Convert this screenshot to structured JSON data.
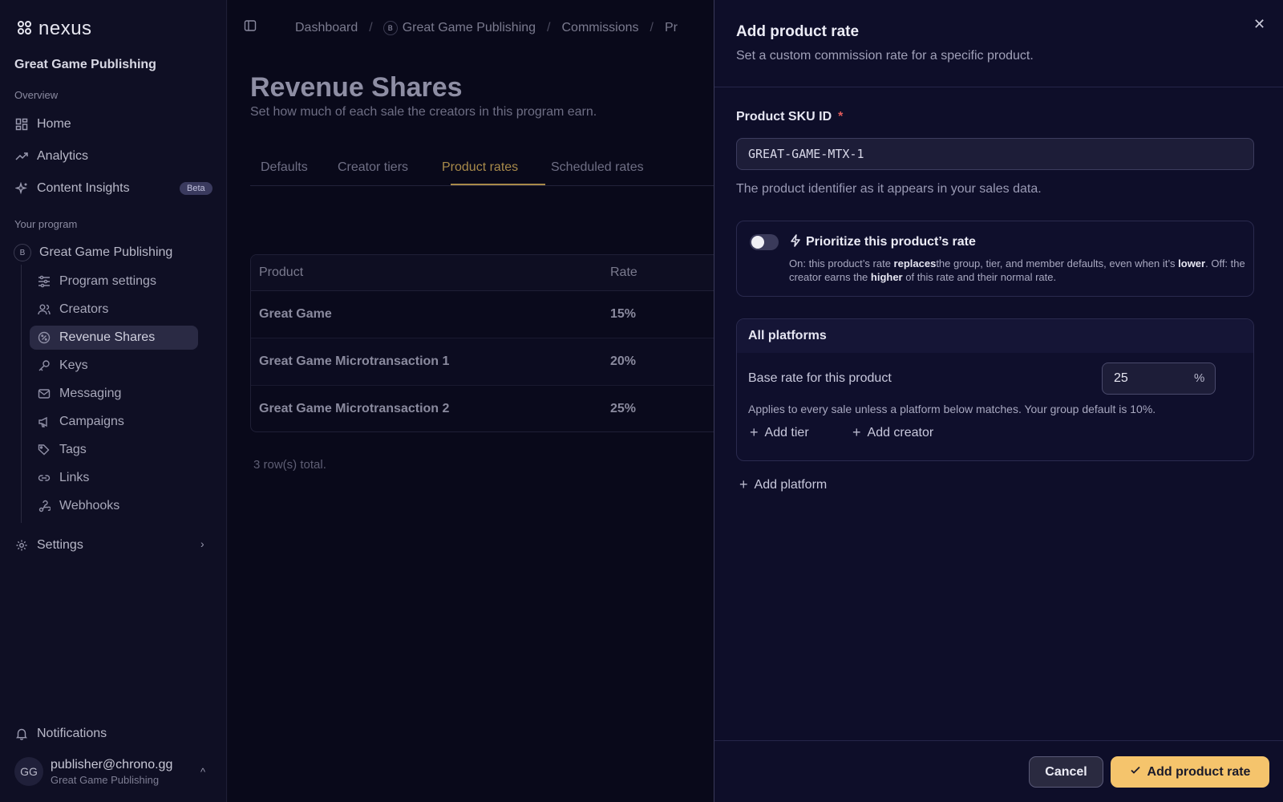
{
  "sidebar": {
    "logo_text": "nexus",
    "org_title": "Great Game Publishing",
    "overview_label": "Overview",
    "nav": [
      {
        "label": "Home"
      },
      {
        "label": "Analytics"
      },
      {
        "label": "Content Insights",
        "badge": "Beta"
      }
    ],
    "program_label": "Your program",
    "program_org": {
      "initial": "B",
      "label": "Great Game Publishing"
    },
    "program_items": [
      {
        "label": "Program settings"
      },
      {
        "label": "Creators"
      },
      {
        "label": "Revenue Shares",
        "active": true
      },
      {
        "label": "Keys"
      },
      {
        "label": "Messaging"
      },
      {
        "label": "Campaigns"
      },
      {
        "label": "Tags"
      },
      {
        "label": "Links"
      },
      {
        "label": "Webhooks"
      }
    ],
    "settings_label": "Settings",
    "notifications_label": "Notifications",
    "user": {
      "initials": "GG",
      "email": "publisher@chrono.gg",
      "org": "Great Game Publishing"
    }
  },
  "breadcrumb": {
    "items": [
      "Dashboard",
      "Great Game Publishing",
      "Commissions",
      "Pr"
    ],
    "org_initial": "B"
  },
  "main": {
    "title": "Revenue Shares",
    "subtitle": "Set how much of each sale the creators in this program earn.",
    "tabs": [
      "Defaults",
      "Creator tiers",
      "Product rates",
      "Scheduled rates"
    ],
    "active_tab": "Product rates",
    "table": {
      "headers": [
        "Product",
        "Rate"
      ],
      "rows": [
        {
          "product": "Great Game",
          "rate": "15%"
        },
        {
          "product": "Great Game Microtransaction 1",
          "rate": "20%"
        },
        {
          "product": "Great Game Microtransaction 2",
          "rate": "25%"
        }
      ]
    },
    "rows_total": "3 row(s) total."
  },
  "drawer": {
    "title": "Add product rate",
    "subtitle": "Set a custom commission rate for a specific product.",
    "sku_label": "Product SKU ID",
    "required_mark": "*",
    "sku_value": "GREAT-GAME-MTX-1",
    "sku_help": "The product identifier as it appears in your sales data.",
    "priority": {
      "title": "Prioritize this product’s rate",
      "enabled": false,
      "desc_1": "On: this product’s rate ",
      "desc_b1": "replaces",
      "desc_2": "the group, tier, and member defaults, even when it’s ",
      "desc_b2": "lower",
      "desc_3": ". Off: the creator earns the ",
      "desc_b3": "higher",
      "desc_4": " of this rate and their normal rate."
    },
    "platforms": {
      "heading": "All platforms",
      "base_label": "Base rate for this product",
      "base_value": "25",
      "unit": "%",
      "applies_text": "Applies to every sale unless a platform below matches. Your group default is 10%.",
      "add_tier": "Add tier",
      "add_creator": "Add creator"
    },
    "add_platform": "Add platform",
    "cancel_label": "Cancel",
    "submit_label": "Add product rate"
  },
  "colors": {
    "accent": "#f5c46c",
    "active_tab": "#a88a4a",
    "required": "#e25b5b"
  }
}
